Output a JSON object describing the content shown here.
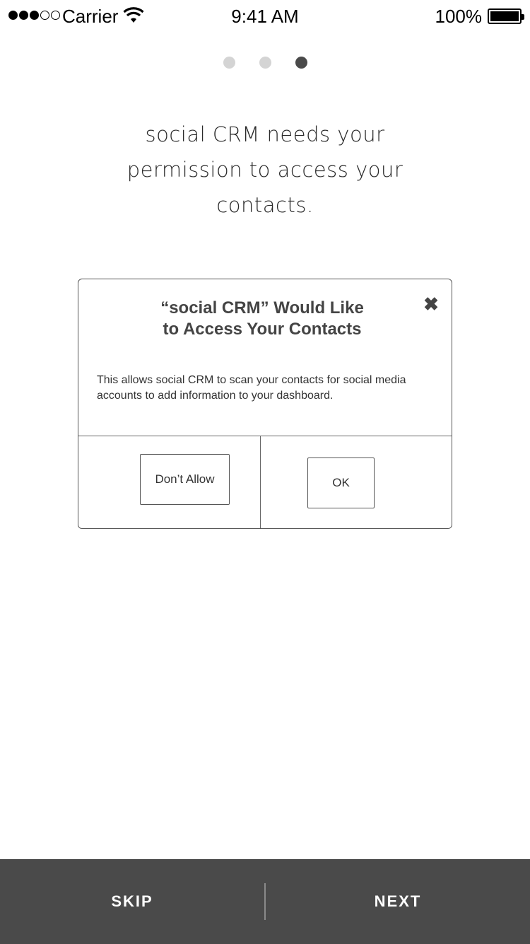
{
  "status_bar": {
    "carrier": "Carrier",
    "time": "9:41 AM",
    "battery": "100%",
    "signal_bars": 3,
    "signal_total": 5
  },
  "onboarding": {
    "page_count": 3,
    "current_page": 3,
    "headline": "social CRM needs your permission to access your contacts."
  },
  "dialog": {
    "title_line1": "“social CRM” Would Like",
    "title_line2": "to Access Your Contacts",
    "body": "This allows social CRM to scan your contacts for social media accounts to add information to your dashboard.",
    "dont_allow_label": "Don’t Allow",
    "ok_label": "OK",
    "close_icon": "close-icon"
  },
  "bottom_bar": {
    "skip_label": "SKIP",
    "next_label": "NEXT",
    "background": "#4a4a4a"
  }
}
